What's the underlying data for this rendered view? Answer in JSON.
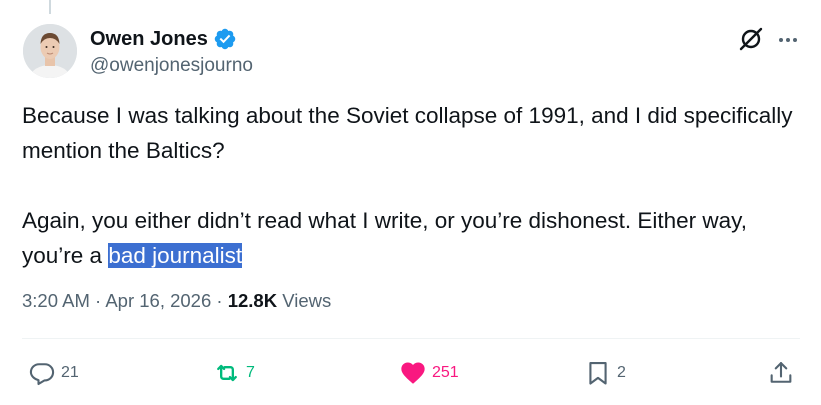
{
  "author": {
    "display_name": "Owen Jones",
    "handle": "@owenjonesjourno",
    "verified": true
  },
  "tweet": {
    "paragraph1": "Because I was talking about the Soviet collapse of 1991, and I did specifically mention the Baltics?",
    "paragraph2_prefix": "Again, you either didn’t read what I write, or you’re dishonest. Either way, you’re a ",
    "paragraph2_selected": "bad journalist"
  },
  "meta": {
    "time": "3:20 AM",
    "separator": " · ",
    "date": "Apr 16, 2026",
    "views_count": "12.8K",
    "views_label": " Views"
  },
  "actions": {
    "reply": {
      "icon": "reply-icon",
      "count": "21"
    },
    "repost": {
      "icon": "repost-icon",
      "count": "7",
      "color": "#00ba7c"
    },
    "like": {
      "icon": "heart-icon",
      "count": "251",
      "color": "#f91880",
      "active": true
    },
    "bookmark": {
      "icon": "bookmark-icon",
      "count": "2"
    },
    "share": {
      "icon": "share-icon"
    }
  },
  "colors": {
    "text_primary": "#0f1419",
    "text_secondary": "#536471",
    "verified_blue": "#1d9bf0",
    "selection_highlight": "#3c6fd1"
  }
}
